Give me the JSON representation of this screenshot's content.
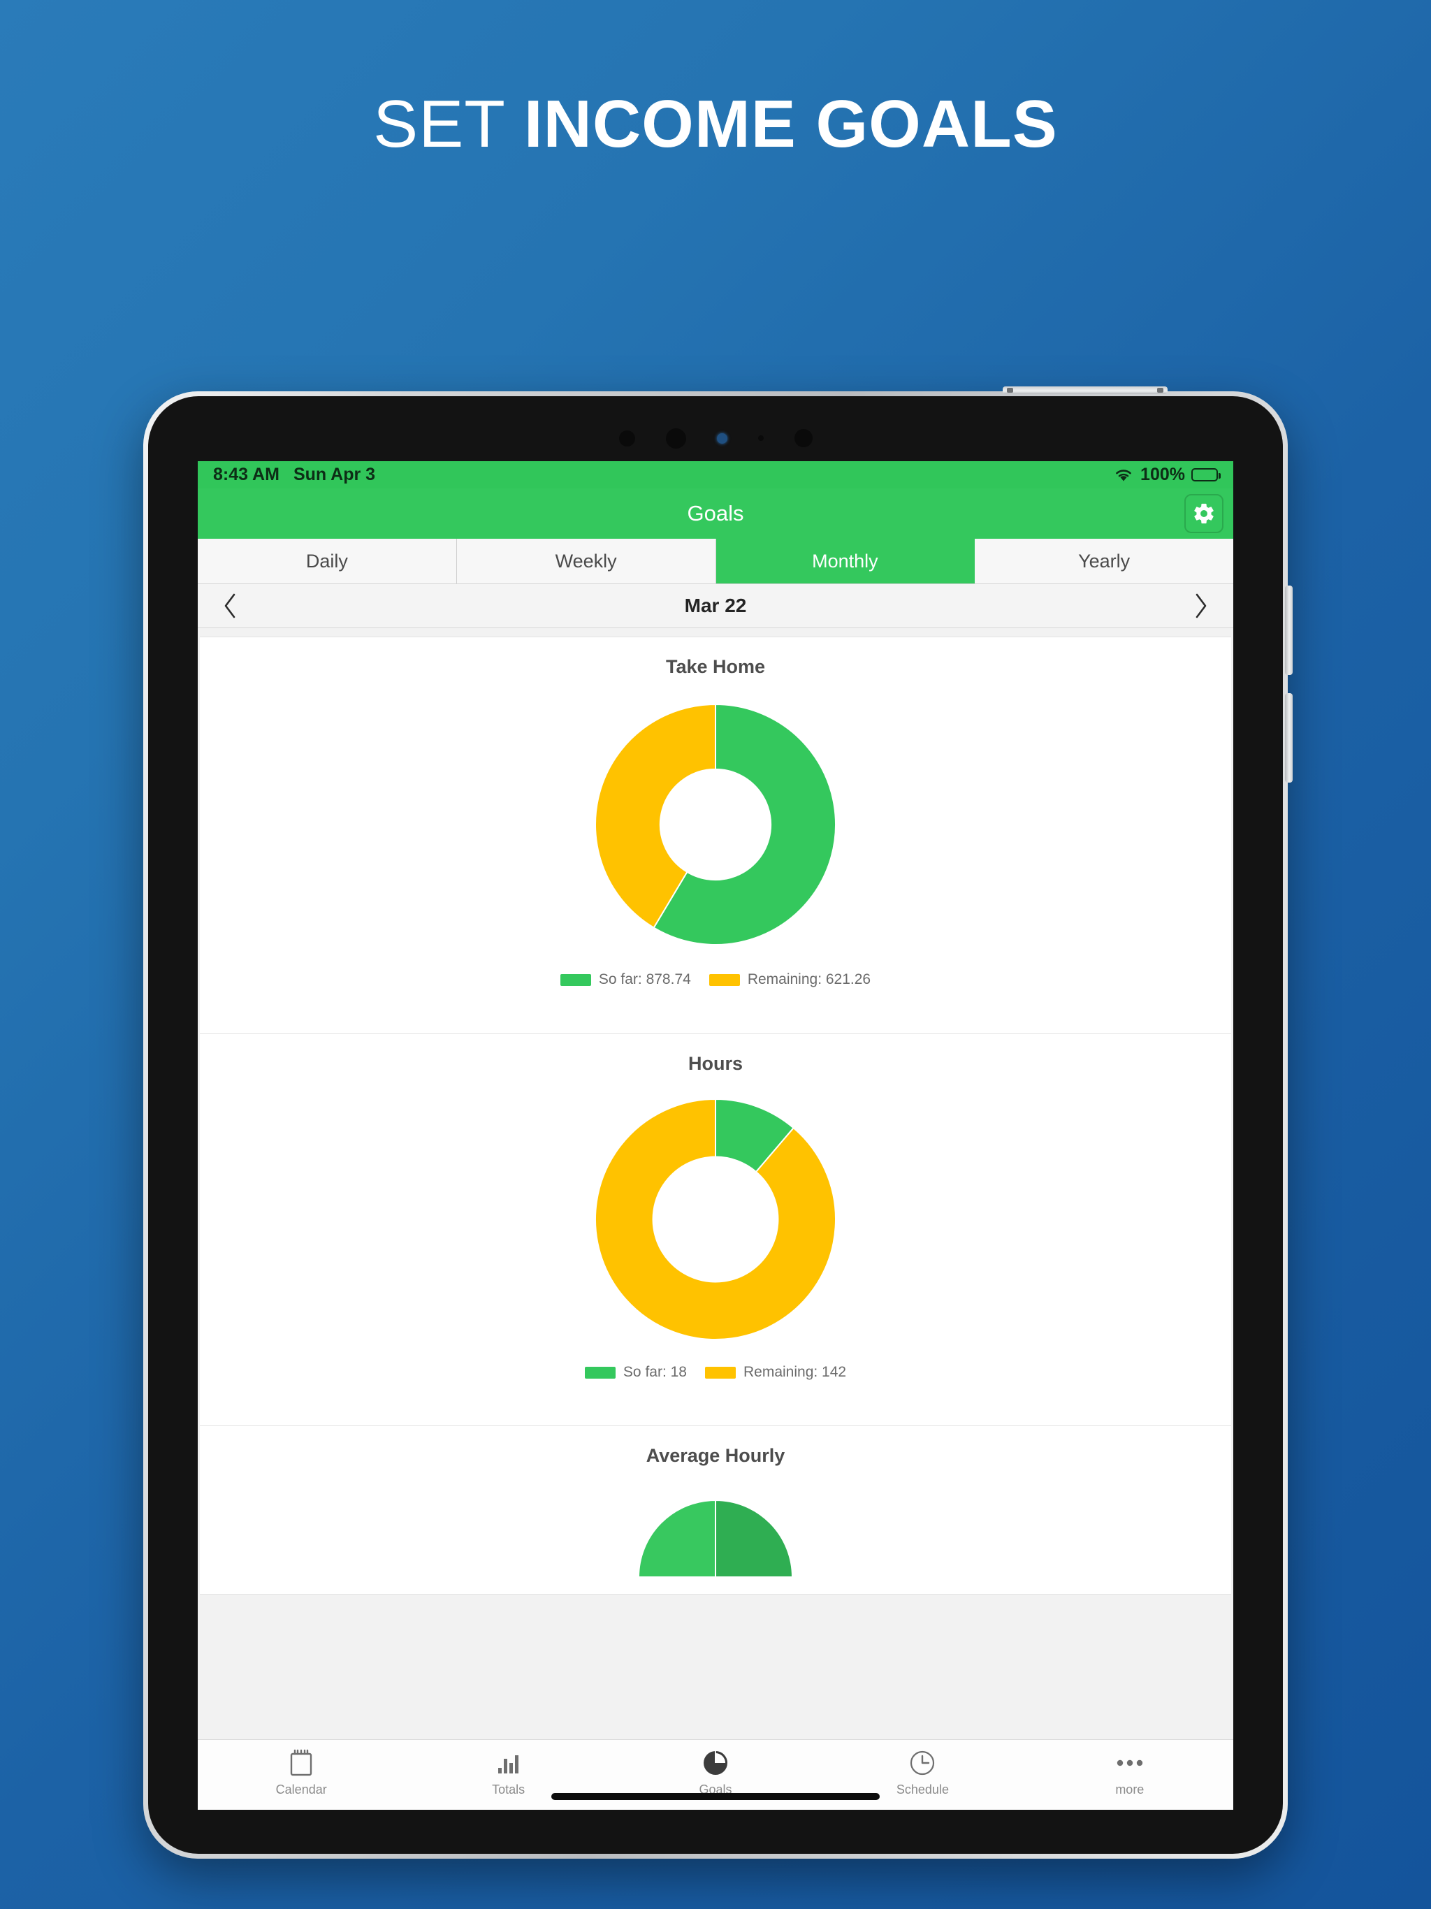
{
  "headline": {
    "light": "SET ",
    "bold": "INCOME GOALS"
  },
  "theme": {
    "bg_top": "#2a7bb9",
    "bg_bottom": "#14549b",
    "accent_green": "#34c85d",
    "accent_yellow": "#ffc200",
    "green_dark": "#2fae52"
  },
  "statusbar": {
    "time": "8:43 AM",
    "date": "Sun Apr 3",
    "wifi_icon": "wifi-icon",
    "battery_percent": "100%",
    "battery_icon": "battery-full-icon"
  },
  "navbar": {
    "title": "Goals",
    "settings_icon": "gear-icon"
  },
  "segments": [
    {
      "label": "Daily",
      "active": false
    },
    {
      "label": "Weekly",
      "active": false
    },
    {
      "label": "Monthly",
      "active": true
    },
    {
      "label": "Yearly",
      "active": false
    }
  ],
  "datenav": {
    "prev_icon": "chevron-left-icon",
    "next_icon": "chevron-right-icon",
    "label": "Mar 22"
  },
  "cards": [
    {
      "title": "Take Home",
      "legend": [
        {
          "label": "So far: 878.74",
          "color": "#34c85d"
        },
        {
          "label": "Remaining: 621.26",
          "color": "#ffc200"
        }
      ]
    },
    {
      "title": "Hours",
      "legend": [
        {
          "label": "So far: 18",
          "color": "#34c85d"
        },
        {
          "label": "Remaining: 142",
          "color": "#ffc200"
        }
      ]
    },
    {
      "title": "Average Hourly",
      "legend": []
    }
  ],
  "tabbar": [
    {
      "label": "Calendar",
      "icon": "calendar-icon",
      "active": false
    },
    {
      "label": "Totals",
      "icon": "bar-chart-icon",
      "active": false
    },
    {
      "label": "Goals",
      "icon": "pie-chart-icon",
      "active": true
    },
    {
      "label": "Schedule",
      "icon": "clock-icon",
      "active": false
    },
    {
      "label": "more",
      "icon": "ellipsis-icon",
      "active": false
    }
  ],
  "chart_data": [
    {
      "type": "pie",
      "title": "Take Home",
      "variant": "donut",
      "labels": [
        "So far",
        "Remaining"
      ],
      "values": [
        878.74,
        621.26
      ],
      "total": 1500.0,
      "colors": [
        "#34c85d",
        "#ffc200"
      ],
      "start_angle_deg": 0,
      "direction": "clockwise",
      "inner_radius_ratio": 0.46,
      "legend_position": "bottom",
      "legend_entries": [
        "So far: 878.74",
        "Remaining: 621.26"
      ]
    },
    {
      "type": "pie",
      "title": "Hours",
      "variant": "donut",
      "labels": [
        "So far",
        "Remaining"
      ],
      "values": [
        18,
        142
      ],
      "total": 160,
      "colors": [
        "#34c85d",
        "#ffc200"
      ],
      "start_angle_deg": 0,
      "direction": "clockwise",
      "inner_radius_ratio": 0.52,
      "legend_position": "bottom",
      "legend_entries": [
        "So far: 18",
        "Remaining: 142"
      ]
    },
    {
      "type": "pie",
      "title": "Average Hourly",
      "variant": "half-donut-gauge",
      "labels": [
        "Left",
        "Right"
      ],
      "values": [
        50,
        50
      ],
      "total": 100,
      "colors": [
        "#38c85f",
        "#2fae52"
      ],
      "legend_position": "none",
      "note": "partially visible, clipped by viewport bottom"
    }
  ]
}
